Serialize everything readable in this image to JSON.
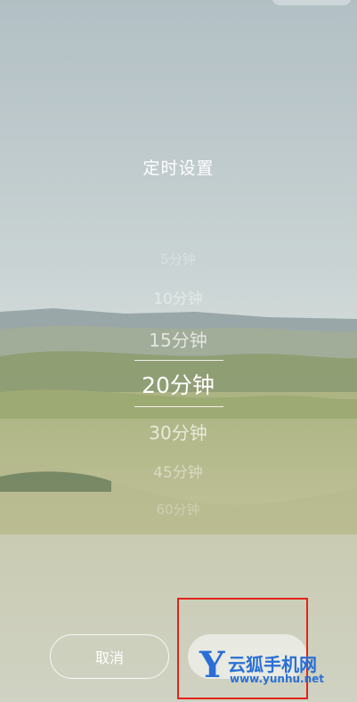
{
  "dialog": {
    "title": "定时设置",
    "options": [
      "5分钟",
      "10分钟",
      "15分钟",
      "20分钟",
      "30分钟",
      "45分钟",
      "60分钟"
    ],
    "selected_index": 3
  },
  "buttons": {
    "cancel_label": "取消"
  },
  "watermark": {
    "brand": "云狐手机网",
    "url": "www.yunhu.net",
    "letter": "Y"
  },
  "colors": {
    "highlight_border": "#e0241b",
    "watermark": "#2a6fd6",
    "text": "#ffffff"
  }
}
